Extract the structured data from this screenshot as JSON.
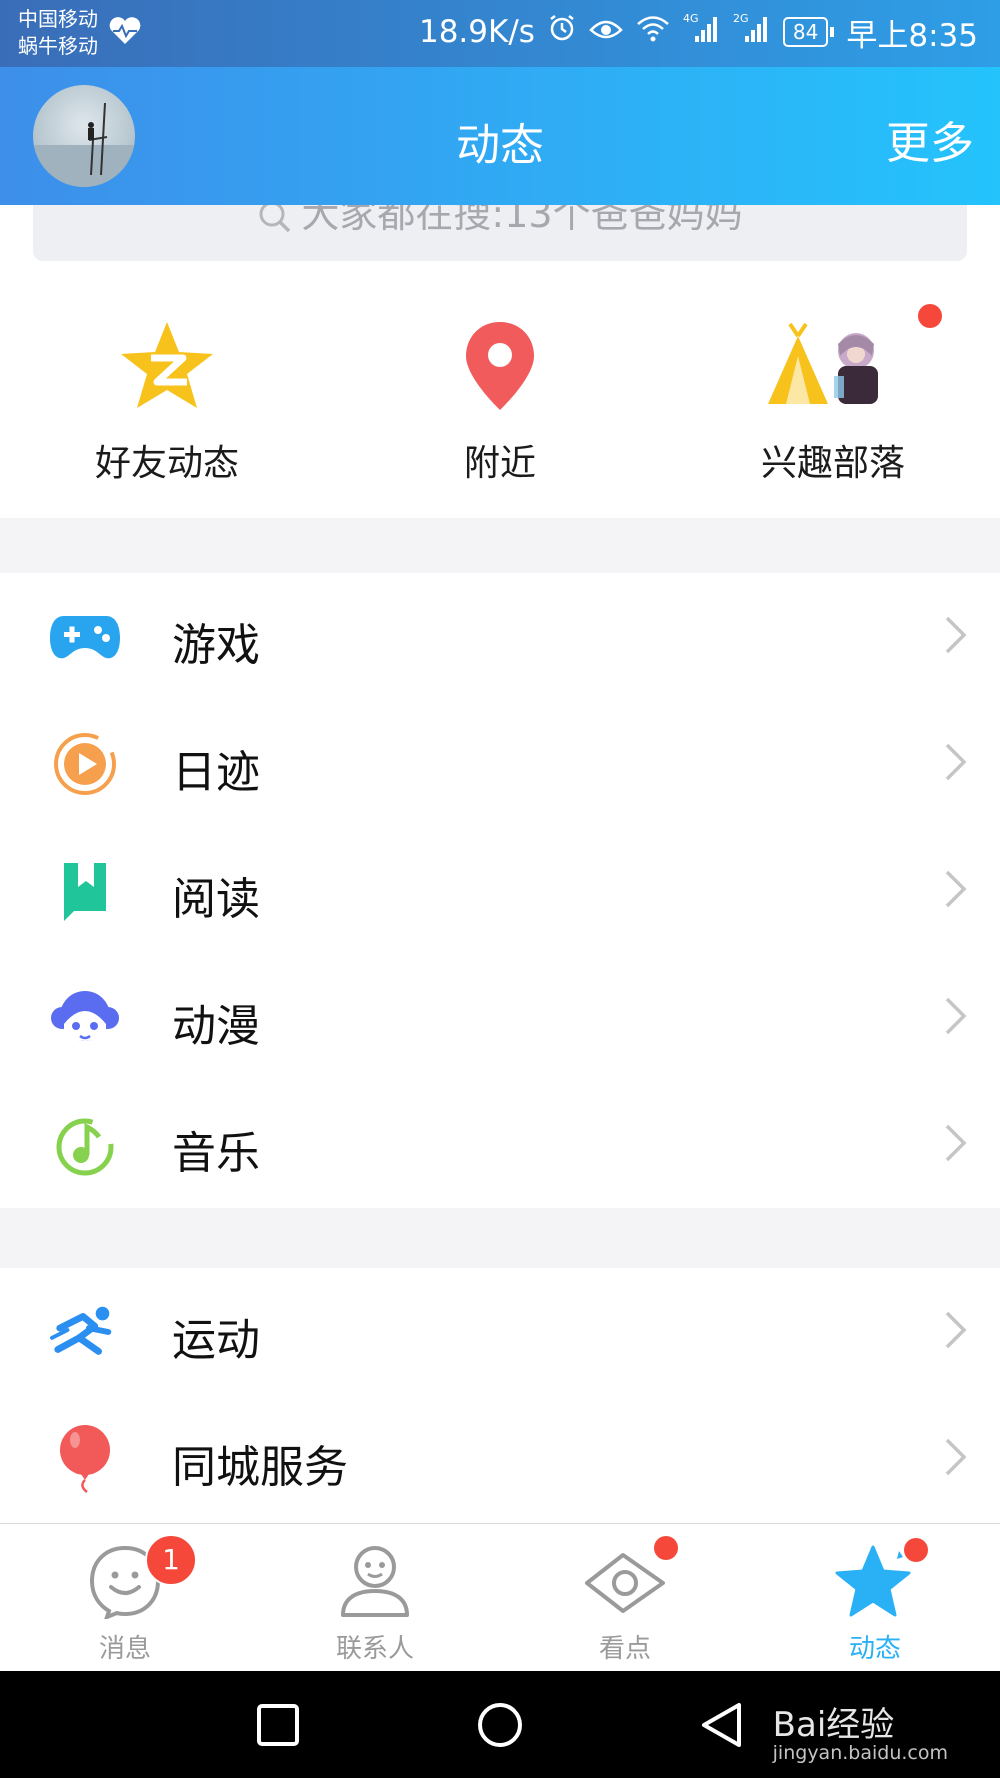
{
  "status_bar": {
    "carrier1": "中国移动",
    "carrier2": "蜗牛移动",
    "net_speed": "18.9K/s",
    "signal1_label": "4G",
    "signal2_label": "2G",
    "battery": "84",
    "time": "早上8:35"
  },
  "header": {
    "title": "动态",
    "more": "更多"
  },
  "search": {
    "placeholder": "大家都在搜:13个爸爸妈妈"
  },
  "quick_entries": [
    {
      "label": "好友动态",
      "icon": "qzone-star-icon"
    },
    {
      "label": "附近",
      "icon": "location-pin-icon"
    },
    {
      "label": "兴趣部落",
      "icon": "tent-icon",
      "has_dot": true
    }
  ],
  "list_section1": [
    {
      "label": "游戏",
      "icon": "gamepad-icon",
      "color": "#29a5f0"
    },
    {
      "label": "日迹",
      "icon": "play-circle-icon",
      "color": "#f6a04d"
    },
    {
      "label": "阅读",
      "icon": "book-icon",
      "color": "#21c59a"
    },
    {
      "label": "动漫",
      "icon": "anime-face-icon",
      "color": "#5a6df0"
    },
    {
      "label": "音乐",
      "icon": "music-note-icon",
      "color": "#86d14d"
    }
  ],
  "list_section2": [
    {
      "label": "运动",
      "icon": "running-icon",
      "color": "#2b8ff2"
    },
    {
      "label": "同城服务",
      "icon": "balloon-icon",
      "color": "#f25a5a"
    }
  ],
  "tabbar": [
    {
      "label": "消息",
      "icon": "message-face-icon",
      "badge": "1"
    },
    {
      "label": "联系人",
      "icon": "contact-person-icon"
    },
    {
      "label": "看点",
      "icon": "eye-icon",
      "has_dot": true
    },
    {
      "label": "动态",
      "icon": "star-icon",
      "has_dot": true,
      "active": true
    }
  ],
  "watermark": {
    "brand": "Bai经验",
    "url": "jingyan.baidu.com"
  },
  "colors": {
    "header_start": "#3d8fea",
    "header_end": "#24c3fc",
    "active_tab": "#2ab0f5",
    "badge": "#f5483a"
  }
}
